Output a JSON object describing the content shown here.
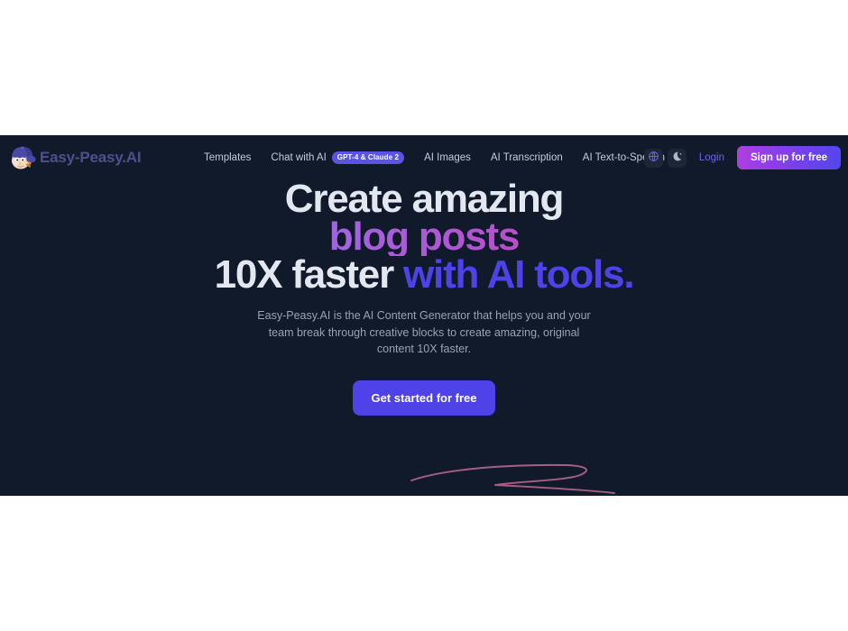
{
  "brand": {
    "name": "Easy-Peasy.AI",
    "mascot_icon": "mascot-face-with-cap-icon"
  },
  "nav": {
    "links": [
      {
        "label": "Templates",
        "badge": null
      },
      {
        "label": "Chat with AI",
        "badge": "GPT-4 & Claude 2"
      },
      {
        "label": "AI Images",
        "badge": null
      },
      {
        "label": "AI Transcription",
        "badge": null
      },
      {
        "label": "AI Text-to-Speech",
        "badge": null
      }
    ],
    "language_icon": "globe-icon",
    "theme_icon": "moon-star-icon",
    "login_label": "Login",
    "signup_label": "Sign up for free"
  },
  "hero": {
    "headline_line1": "Create amazing",
    "headline_line2": "blog posts",
    "headline_line3_plain": "10X faster ",
    "headline_line3_accent": "with AI tools.",
    "subtitle": "Easy-Peasy.AI is the AI Content Generator that helps you and your team break through creative blocks to create amazing, original content 10X faster.",
    "cta_label": "Get started for free",
    "underline_icon": "hand-drawn-underline-swoosh-icon"
  },
  "colors": {
    "page_background": "#ffffff",
    "section_background": "#111a2b",
    "accent_indigo": "#4f42e8",
    "badge_purple": "#5b52e8",
    "login_violet": "#6a63f0",
    "brand_slate_purple": "#4f4f8f",
    "heading_white": "#e3e8f0",
    "subtitle_gray": "#98a2b8",
    "squiggle_mauve": "#a55f85",
    "gradient_start": "#7b8cf0",
    "gradient_end": "#e0356f",
    "icon_button_bg": "#1d2537"
  }
}
